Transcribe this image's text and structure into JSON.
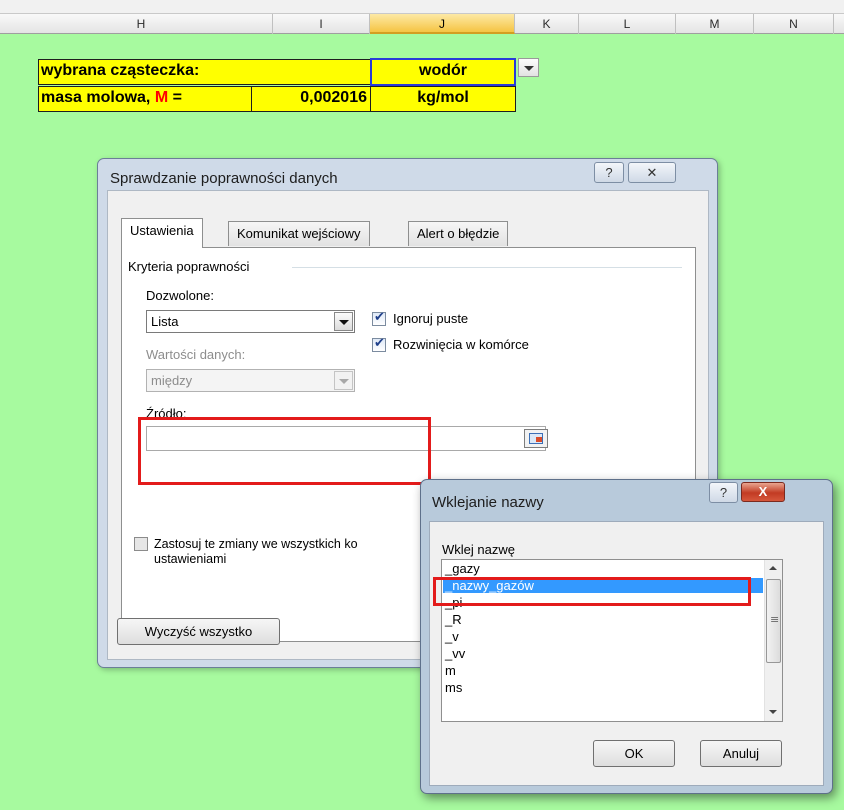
{
  "spreadsheet": {
    "columns": [
      "H",
      "I",
      "J",
      "K",
      "L",
      "M",
      "N"
    ],
    "row1": {
      "label": "wybrana cząsteczka:",
      "value": "wodór"
    },
    "row2": {
      "label_prefix": "masa molowa, ",
      "label_symbol": "M",
      "label_suffix": " =",
      "value": "0,002016",
      "unit": "kg/mol"
    }
  },
  "dialog_validation": {
    "title": "Sprawdzanie poprawności danych",
    "help_glyph": "?",
    "close_glyph": "✕",
    "tabs": [
      "Ustawienia",
      "Komunikat wejściowy",
      "Alert o błędzie"
    ],
    "group_label": "Kryteria poprawności",
    "allow_label": "Dozwolone:",
    "allow_value": "Lista",
    "data_label": "Wartości danych:",
    "data_value": "między",
    "ignore_blank": "Ignoruj puste",
    "in_cell_dropdown": "Rozwinięcia w komórce",
    "source_label": "Źródło:",
    "source_value": "",
    "apply_line1": "Zastosuj te zmiany we wszystkich ko",
    "apply_line2": "ustawieniami",
    "clear_all": "Wyczyść wszystko"
  },
  "dialog_paste_name": {
    "title": "Wklejanie nazwy",
    "help_glyph": "?",
    "close_glyph": "X",
    "list_label": "Wklej nazwę",
    "items": [
      "_gazy",
      "_nazwy_gazów",
      "_pi",
      "_R",
      "_v",
      "_vv",
      "m",
      "ms"
    ],
    "selected_index": 1,
    "ok": "OK",
    "cancel": "Anuluj"
  }
}
